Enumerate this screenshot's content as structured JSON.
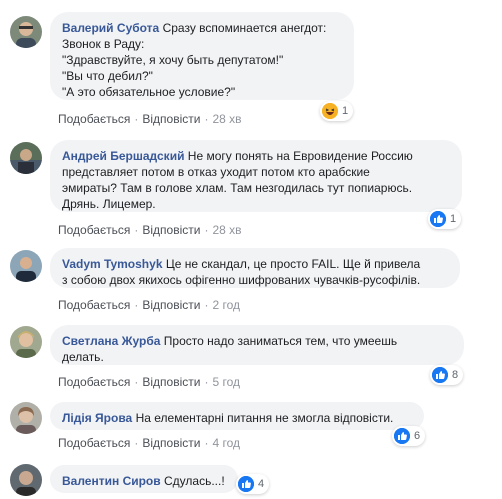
{
  "actions": {
    "like": "Подобається",
    "reply": "Відповісти"
  },
  "comments": [
    {
      "author": "Валерий Субота",
      "text": "Сразу вспоминается анегдот:\nЗвонок в Раду:\n\"Здравствуйте, я хочу быть депутатом!\"\n\"Вы что дебил?\"\n\"А это обязательное условие?\"",
      "time": "28 хв",
      "reactions": {
        "icon": "haha-icon",
        "count": "1"
      }
    },
    {
      "author": "Андрей Бершадский",
      "text": "Не могу понять на Евровидение Россию\nпредставляет потом в отказ уходит потом кто арабские\nэмираты? Там в голове хлам. Там незгодилась тут попиарюсь.\nДрянь. Лицемер.",
      "time": "28 хв",
      "reactions": {
        "icon": "like-icon",
        "count": "1"
      }
    },
    {
      "author": "Vadym Tymoshyk",
      "text": "Це не скандал, це просто FAIL. Ще й привела\nз собою двох якихось офігенно шифрованих чувачків-русофілів.",
      "time": "2 год",
      "reactions": null
    },
    {
      "author": "Светлана Журба",
      "text": "Просто надо заниматься тем, что умеешь\nделать.",
      "time": "5 год",
      "reactions": {
        "icon": "like-icon",
        "count": "8"
      }
    },
    {
      "author": "Лідія Ярова",
      "text": "На елементарні питання не змогла відповісти.",
      "time": "4 год",
      "reactions": {
        "icon": "like-icon",
        "count": "6"
      }
    },
    {
      "author": "Валентин Сиров",
      "text": "Сдулась...!",
      "time": "",
      "reactions": {
        "icon": "like-icon",
        "count": "4"
      }
    }
  ],
  "colors": {
    "author": "#385898",
    "bubble": "#f2f3f5",
    "like": "#1877f2",
    "haha": "#f7b125"
  }
}
